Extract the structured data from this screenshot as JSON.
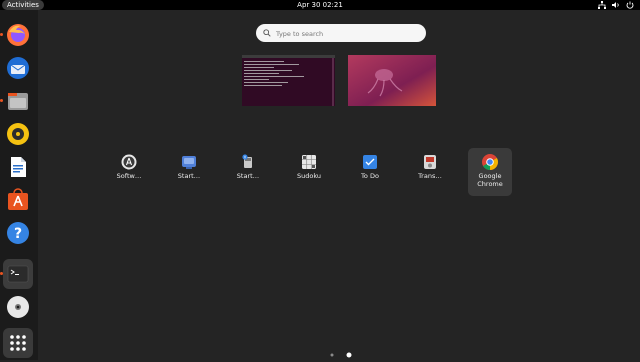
{
  "topbar": {
    "activities_label": "Activities",
    "clock": "Apr 30  02:21"
  },
  "search": {
    "placeholder": "Type to search"
  },
  "dock": {
    "items": [
      {
        "name": "Firefox",
        "running": true
      },
      {
        "name": "Thunderbird",
        "running": false
      },
      {
        "name": "Files",
        "running": true
      },
      {
        "name": "Rhythmbox",
        "running": false
      },
      {
        "name": "LibreOffice Writer",
        "running": false
      },
      {
        "name": "Ubuntu Software",
        "running": false
      },
      {
        "name": "Help",
        "running": false
      },
      {
        "name": "Terminal",
        "running": true
      },
      {
        "name": "DVD",
        "running": false
      },
      {
        "name": "Show Applications",
        "running": false
      }
    ]
  },
  "apps": [
    {
      "label": "Softw…",
      "icon": "software-icon"
    },
    {
      "label": "Start…",
      "icon": "startup-disk-icon"
    },
    {
      "label": "Start…",
      "icon": "startup-apps-icon"
    },
    {
      "label": "Sudoku",
      "icon": "sudoku-icon"
    },
    {
      "label": "To Do",
      "icon": "todo-icon"
    },
    {
      "label": "Trans…",
      "icon": "transmission-icon"
    },
    {
      "label": "Google Chrome",
      "icon": "chrome-icon"
    }
  ],
  "pagination": {
    "pages": 2,
    "current": 2
  }
}
